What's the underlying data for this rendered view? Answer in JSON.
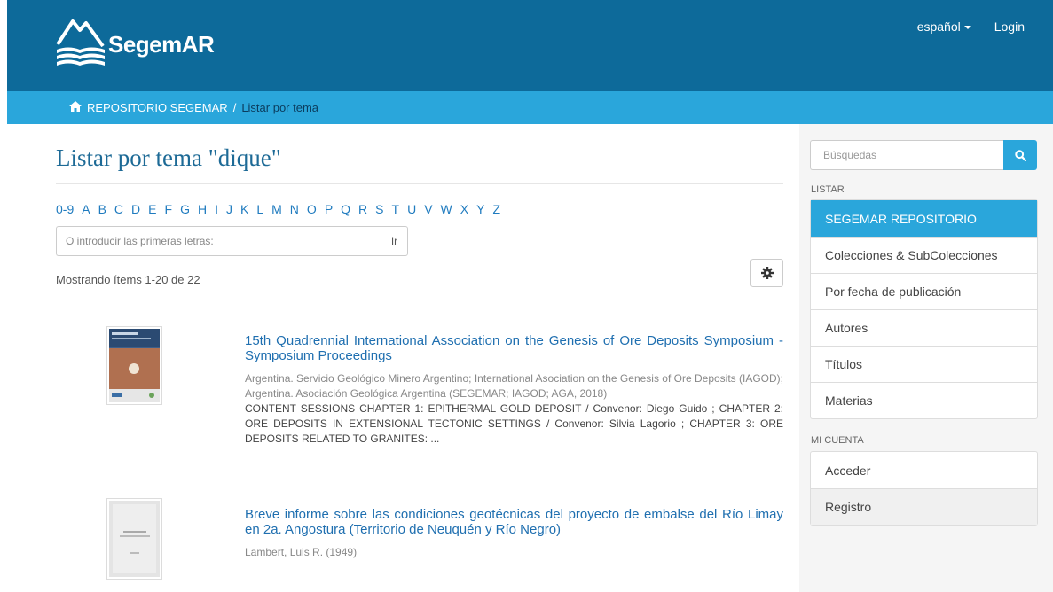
{
  "header": {
    "brand": "SegemAR",
    "language": "español",
    "login": "Login"
  },
  "trail": {
    "home": "REPOSITORIO SEGEMAR",
    "separator": "/",
    "current": "Listar por tema"
  },
  "main": {
    "title": "Listar por tema \"dique\"",
    "letters": [
      "0-9",
      "A",
      "B",
      "C",
      "D",
      "E",
      "F",
      "G",
      "H",
      "I",
      "J",
      "K",
      "L",
      "M",
      "N",
      "O",
      "P",
      "Q",
      "R",
      "S",
      "T",
      "U",
      "V",
      "W",
      "X",
      "Y",
      "Z"
    ],
    "starts_placeholder": "O introducir las primeras letras:",
    "go_label": "Ir",
    "showing": "Mostrando ítems 1-20 de 22"
  },
  "items": [
    {
      "title": "15th Quadrennial International Association on the Genesis of Ore Deposits Symposium - Symposium Proceedings",
      "authors": "Argentina. Servicio Geológico Minero Argentino; International Asociation on the Genesis of Ore Deposits (IAGOD); Argentina. Asociación Geológica Argentina (SEGEMAR; IAGOD; AGA, 2018)",
      "abstract": "CONTENT SESSIONS CHAPTER 1: EPITHERMAL GOLD DEPOSIT / Convenor: Diego Guido ; CHAPTER 2: ORE DEPOSITS IN EXTENSIONAL TECTONIC SETTINGS / Convenor: Silvia Lagorio ; CHAPTER 3: ORE DEPOSITS RELATED TO GRANITES: ..."
    },
    {
      "title": "Breve informe sobre las condiciones geotécnicas del proyecto de embalse del Río Limay en 2a. Angostura (Territorio de Neuquén y Río Negro)",
      "authors": "Lambert, Luis R. (1949)"
    }
  ],
  "sidebar": {
    "search_placeholder": "Búsquedas",
    "browse_heading": "LISTAR",
    "browse": [
      "SEGEMAR REPOSITORIO",
      "Colecciones & SubColecciones",
      "Por fecha de publicación",
      "Autores",
      "Títulos",
      "Materias"
    ],
    "account_heading": "MI CUENTA",
    "account": [
      "Acceder",
      "Registro"
    ]
  },
  "colors": {
    "header": "#0d6a9a",
    "trail": "#2aa6db",
    "link": "#1f6fb0",
    "sidebar": "#f5f5f5"
  }
}
